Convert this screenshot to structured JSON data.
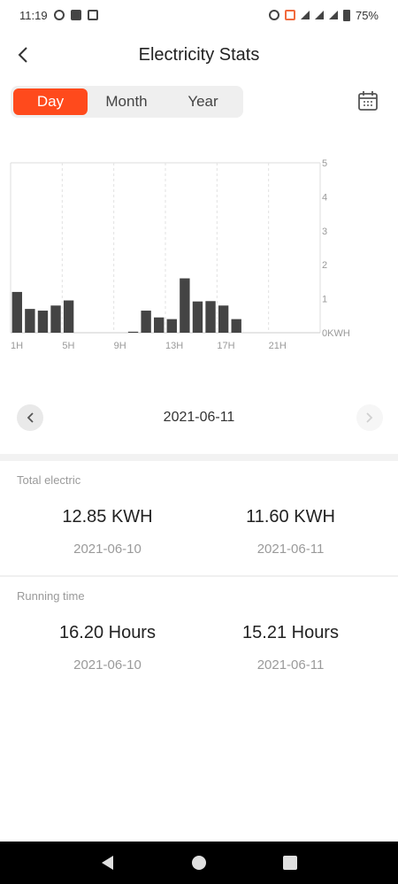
{
  "status_bar": {
    "time": "11:19",
    "battery": "75%"
  },
  "header": {
    "title": "Electricity Stats",
    "back_icon": "chevron-left-icon"
  },
  "tabs": [
    {
      "label": "Day",
      "active": true
    },
    {
      "label": "Month",
      "active": false
    },
    {
      "label": "Year",
      "active": false
    }
  ],
  "calendar_icon": "calendar-icon",
  "chart_data": {
    "type": "bar",
    "x": [
      "1H",
      "2H",
      "3H",
      "4H",
      "5H",
      "6H",
      "7H",
      "8H",
      "9H",
      "10H",
      "11H",
      "12H",
      "13H",
      "14H",
      "15H",
      "16H",
      "17H",
      "18H",
      "19H",
      "20H",
      "21H",
      "22H",
      "23H",
      "24H"
    ],
    "x_tick_labels": [
      "1H",
      "5H",
      "9H",
      "13H",
      "17H",
      "21H"
    ],
    "values": [
      1.2,
      0.7,
      0.65,
      0.8,
      0.95,
      0,
      0,
      0,
      0,
      0.03,
      0.65,
      0.45,
      0.4,
      1.6,
      0.92,
      0.93,
      0.8,
      0.4,
      0,
      0,
      0,
      0,
      0,
      0
    ],
    "ylim": [
      0,
      5
    ],
    "y_ticks": [
      "0KWH",
      "1",
      "2",
      "3",
      "4",
      "5"
    ],
    "bar_color": "#444444",
    "grid": true
  },
  "date_nav": {
    "current_date": "2021-06-11"
  },
  "total_electric": {
    "label": "Total electric",
    "prev_value": "12.85 KWH",
    "prev_date": "2021-06-10",
    "curr_value": "11.60 KWH",
    "curr_date": "2021-06-11"
  },
  "running_time": {
    "label": "Running time",
    "prev_value": "16.20 Hours",
    "prev_date": "2021-06-10",
    "curr_value": "15.21 Hours",
    "curr_date": "2021-06-11"
  },
  "colors": {
    "accent": "#ff4a1c",
    "bar": "#444444"
  }
}
